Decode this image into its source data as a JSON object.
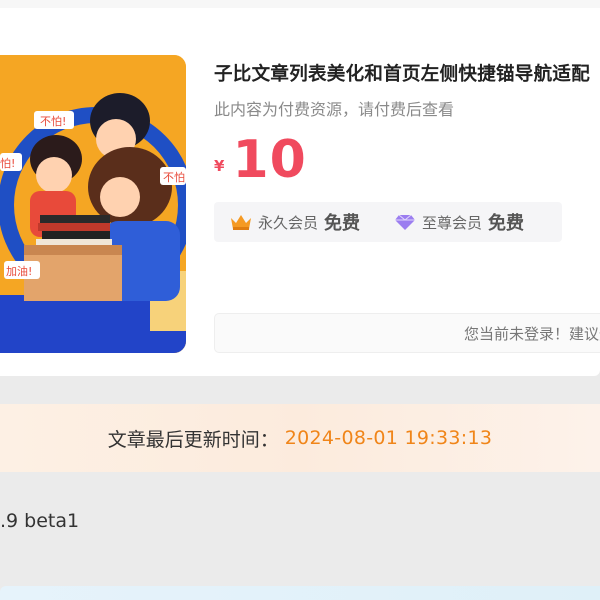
{
  "article": {
    "title": "子比文章列表美化和首页左侧快捷锚导航适配",
    "subtitle": "此内容为付费资源，请付费后查看",
    "currency": "¥",
    "price": "10",
    "price_color": "#f04a5e",
    "thumbnail_labels": [
      "不怕!",
      "怕!",
      "不怕",
      "加油!"
    ]
  },
  "vip": {
    "permanent": {
      "label": "永久会员",
      "badge": "免费",
      "icon": "crown-icon"
    },
    "supreme": {
      "label": "至尊会员",
      "badge": "免费",
      "icon": "diamond-icon"
    }
  },
  "login_notice": "您当前未登录！建议登",
  "update": {
    "label": "文章最后更新时间：",
    "value": "2024-08-01 19:33:13",
    "value_color": "#f08519"
  },
  "version_text": ".9 beta1"
}
